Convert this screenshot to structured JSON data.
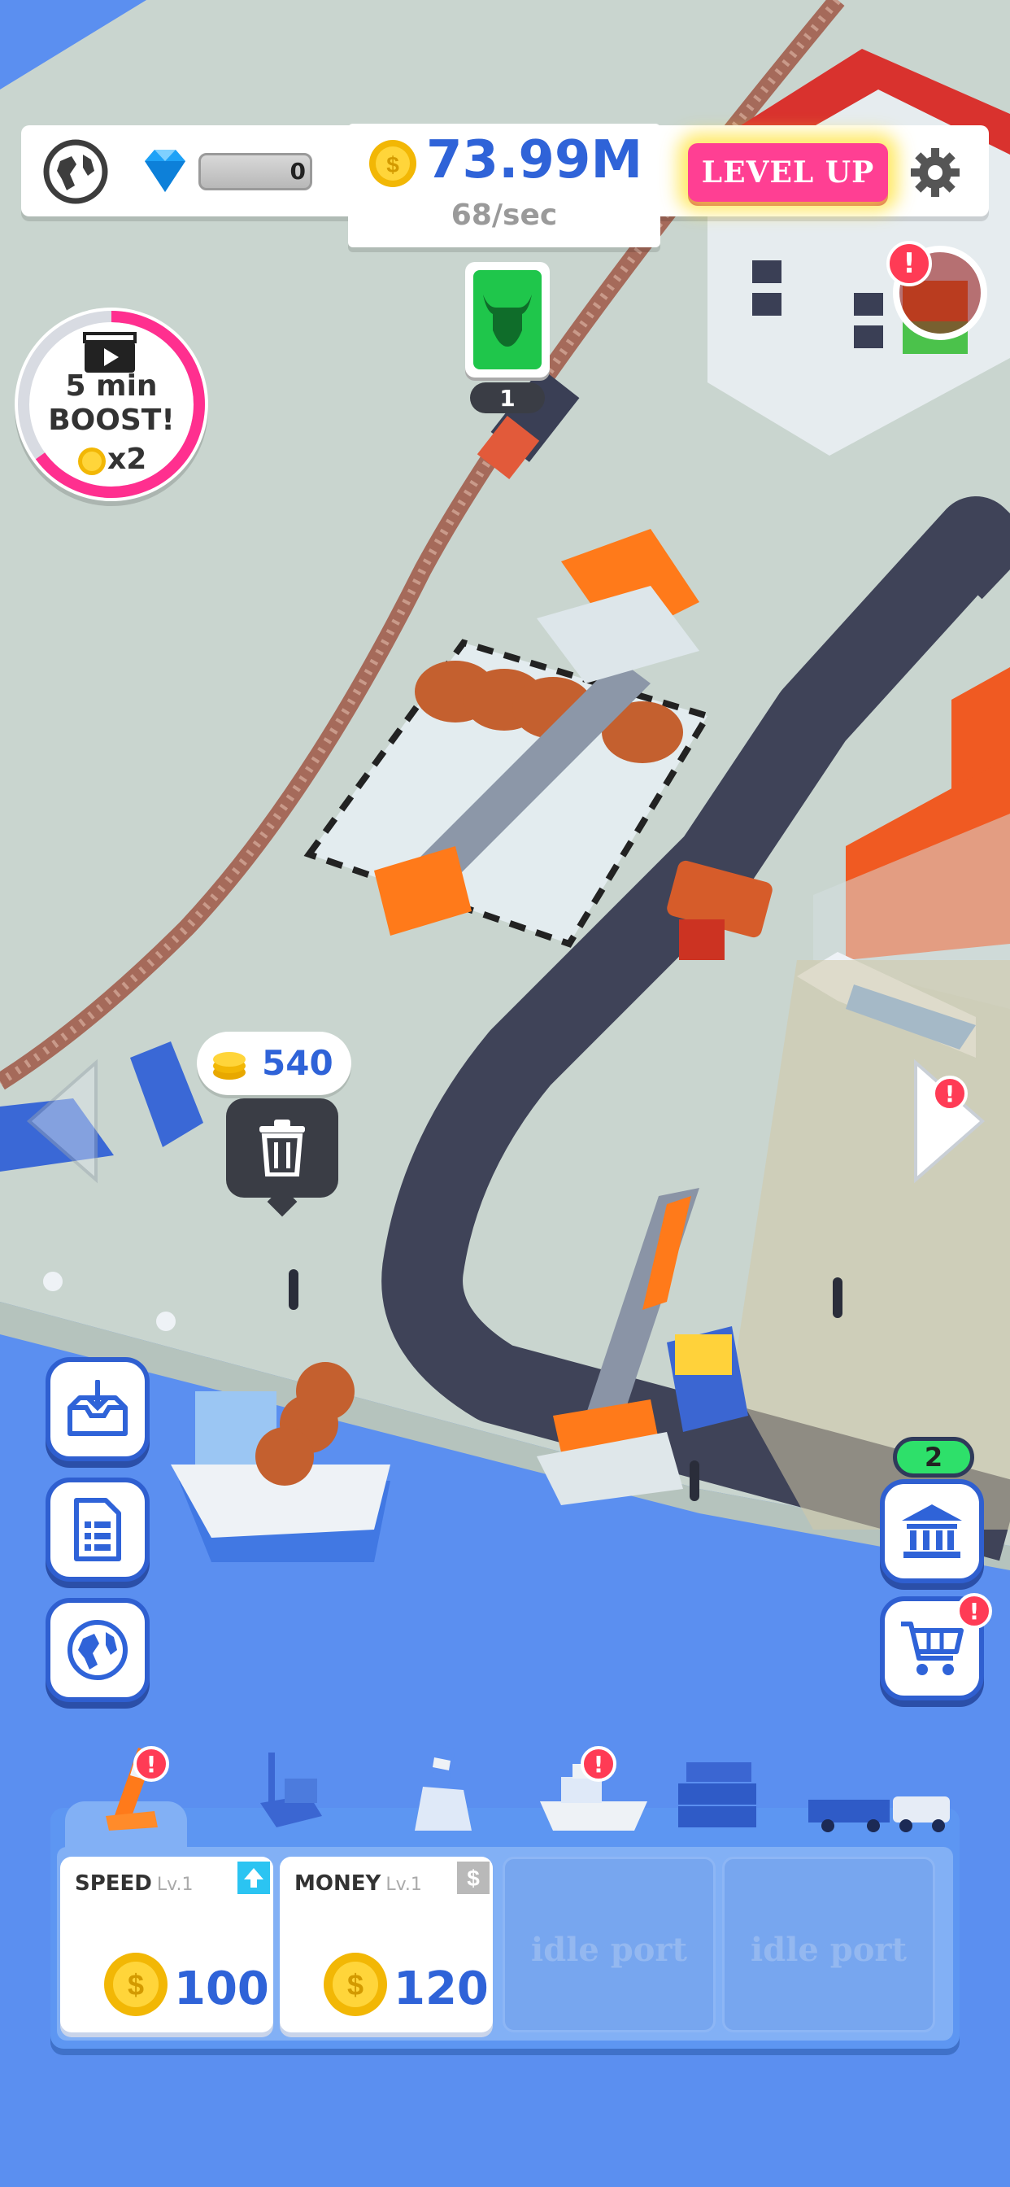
{
  "colors": {
    "ground": "#c9d5cf",
    "water": "#5b8ff0",
    "road": "#3f4358",
    "accent_blue": "#2f63d8",
    "level_up_pink": "#ff3f93",
    "alert_red": "#ff3b55"
  },
  "top_bar": {
    "globe_icon": "globe-icon",
    "gem_icon": "diamond-icon",
    "gems": "0",
    "money": "73.99M",
    "rate": "68/sec",
    "level_up_label": "LEVEL UP",
    "settings_icon": "gear-icon"
  },
  "train_indicator": {
    "icon": "bull-icon",
    "count": "1"
  },
  "boost": {
    "line1": "5 min",
    "line2": "BOOST!",
    "multiplier": "x2",
    "progress": 0.65
  },
  "trash_popup": {
    "value": "540",
    "icon": "trash-icon"
  },
  "left_buttons": [
    {
      "icon": "inbox-download-icon"
    },
    {
      "icon": "document-icon"
    },
    {
      "icon": "globe-icon"
    }
  ],
  "right_buttons": {
    "bank_count": "2",
    "bank_icon": "bank-icon",
    "cart_icon": "cart-icon"
  },
  "tabs": [
    {
      "icon": "crane-icon",
      "alert": true
    },
    {
      "icon": "forklift-icon",
      "alert": false
    },
    {
      "icon": "tower-icon",
      "alert": false
    },
    {
      "icon": "ship-icon",
      "alert": true
    },
    {
      "icon": "container-icon",
      "alert": false
    },
    {
      "icon": "truck-icon",
      "alert": false
    }
  ],
  "upgrades": [
    {
      "name": "SPEED",
      "level": "Lv.1",
      "price": "100",
      "tag_icon": "up-arrow-icon"
    },
    {
      "name": "MONEY",
      "level": "Lv.1",
      "price": "120",
      "tag_icon": "dollar-icon"
    },
    {
      "idle": "idle port"
    },
    {
      "idle": "idle port"
    }
  ]
}
